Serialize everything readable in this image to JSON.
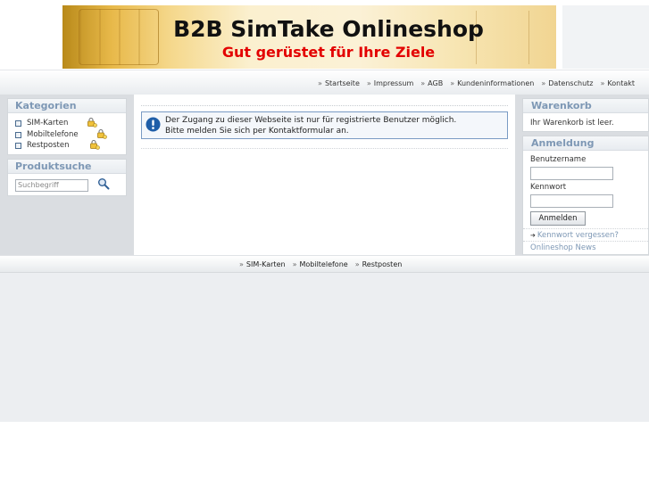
{
  "header": {
    "title": "B2B SimTake Onlineshop",
    "subtitle": "Gut gerüstet für Ihre Ziele"
  },
  "topnav": {
    "separator": "»",
    "items": [
      "Startseite",
      "Impressum",
      "AGB",
      "Kundeninformationen",
      "Datenschutz",
      "Kontakt"
    ]
  },
  "categories": {
    "title": "Kategorien",
    "items": [
      "SIM-Karten",
      "Mobiltelefone",
      "Restposten"
    ]
  },
  "product_search": {
    "title": "Produktsuche",
    "placeholder": "Suchbegriff",
    "button_icon": "magnifier-icon"
  },
  "notice": {
    "icon": "info-icon",
    "line1": "Der Zugang zu dieser Webseite ist nur für registrierte Benutzer möglich.",
    "line2": "Bitte melden Sie sich per Kontaktformular an."
  },
  "cart": {
    "title": "Warenkorb",
    "text": "Ihr Warenkorb ist leer."
  },
  "login": {
    "title": "Anmeldung",
    "username_label": "Benutzername",
    "password_label": "Kennwort",
    "button": "Anmelden",
    "forgot": "Kennwort vergessen?",
    "news": "Onlineshop News"
  },
  "bottomnav": {
    "separator": "»",
    "items": [
      "SIM-Karten",
      "Mobiltelefone",
      "Restposten"
    ]
  },
  "colors": {
    "box_title": "#7e98b5",
    "subtitle_red": "#e30000",
    "side_bg": "#dadde1"
  }
}
